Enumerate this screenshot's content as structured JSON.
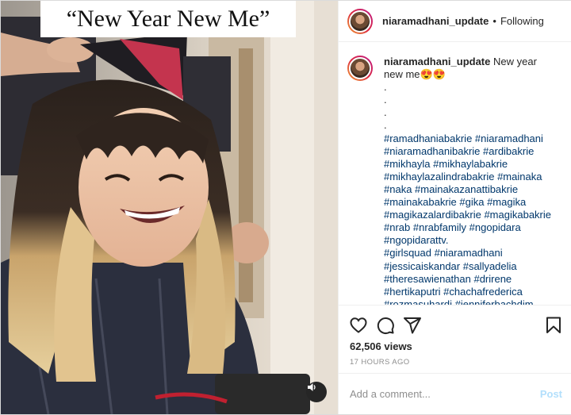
{
  "media": {
    "overlay_caption": "“New Year New Me”"
  },
  "header": {
    "username": "niaramadhani_update",
    "separator": "•",
    "follow_status": "Following"
  },
  "caption": {
    "username": "niaramadhani_update",
    "text": "New year new me😍😍",
    "dots": [
      ".",
      ".",
      ".",
      "."
    ],
    "hashtags": [
      "#ramadhaniabakrie #niaramadhani",
      "#niaramadhanibakrie #ardibakrie",
      "#mikhayla #mikhaylabakrie",
      "#mikhaylazalindrabakrie #mainaka",
      "#naka #mainakazanattibakrie",
      "#mainakabakrie #gika #magika",
      "#magikazalardibakrie #magikabakrie",
      "#nrab #nrabfamily #ngopidara",
      "#ngopidarattv.",
      "#girlsquad #niaramadhani",
      "#jessicaiskandar #sallyadelia",
      "#theresawienathan #drirene",
      "#hertikaputri #chachafrederica",
      "#rozmasuhardi #jenniferbachdim"
    ]
  },
  "actions": {
    "like_icon": "heart-icon",
    "comment_icon": "comment-icon",
    "share_icon": "paper-plane-icon",
    "save_icon": "bookmark-icon"
  },
  "stats": {
    "views": "62,506 views",
    "timestamp": "17 HOURS AGO"
  },
  "add_comment": {
    "placeholder": "Add a comment...",
    "post_label": "Post"
  },
  "colors": {
    "link": "#00376b",
    "muted": "#8e8e8e",
    "post_disabled": "#b2dffc",
    "text": "#262626"
  }
}
